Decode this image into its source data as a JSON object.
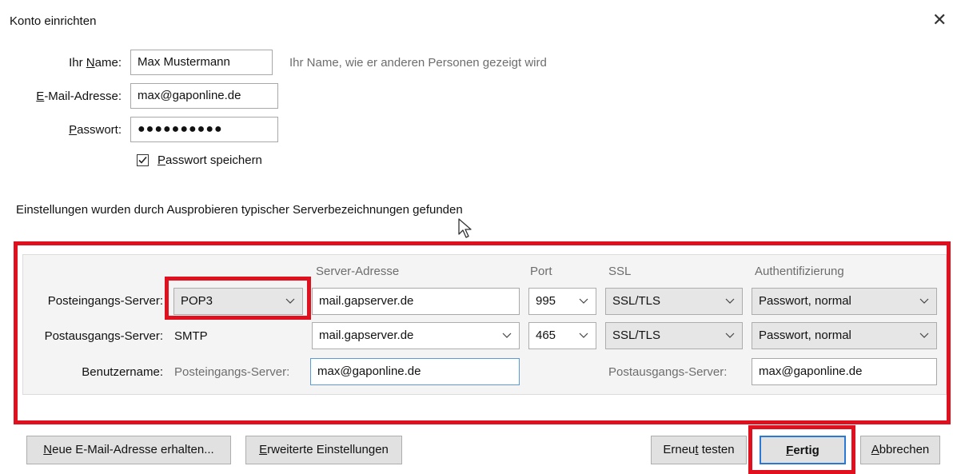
{
  "dialog": {
    "title": "Konto einrichten",
    "close_glyph": "✕"
  },
  "identity": {
    "name_label_pre": "Ihr ",
    "name_label_accel": "N",
    "name_label_post": "ame:",
    "name_value": "Max Mustermann",
    "name_hint": "Ihr Name, wie er anderen Personen gezeigt wird",
    "email_label_accel": "E",
    "email_label_post": "-Mail-Adresse:",
    "email_value": "max@gaponline.de",
    "password_label_accel": "P",
    "password_label_post": "asswort:",
    "password_value": "●●●●●●●●●●",
    "save_password_accel": "P",
    "save_password_post": "asswort speichern",
    "save_password_checked": true
  },
  "status_message": "Einstellungen wurden durch Ausprobieren typischer Serverbezeichnungen gefunden",
  "server_table": {
    "headers": {
      "address": "Server-Adresse",
      "port": "Port",
      "ssl": "SSL",
      "auth": "Authentifizierung"
    },
    "incoming": {
      "label": "Posteingangs-Server:",
      "protocol": "POP3",
      "address": "mail.gapserver.de",
      "port": "995",
      "ssl": "SSL/TLS",
      "auth": "Passwort, normal"
    },
    "outgoing": {
      "label": "Postausgangs-Server:",
      "protocol": "SMTP",
      "address": "mail.gapserver.de",
      "port": "465",
      "ssl": "SSL/TLS",
      "auth": "Passwort, normal"
    },
    "username": {
      "label": "Benutzername:",
      "incoming_label": "Posteingangs-Server:",
      "incoming_value": "max@gaponline.de",
      "outgoing_label": "Postausgangs-Server:",
      "outgoing_value": "max@gaponline.de"
    }
  },
  "buttons": {
    "new_address_accel": "N",
    "new_address_post": "eue E-Mail-Adresse erhalten...",
    "advanced_accel": "E",
    "advanced_post": "rweiterte Einstellungen",
    "retest_pre": "Erneu",
    "retest_accel": "t",
    "retest_post": " testen",
    "done_accel": "F",
    "done_post": "ertig",
    "cancel_accel": "A",
    "cancel_post": "bbrechen"
  },
  "annotation_color": "#e0101e",
  "icons": [
    "close-icon",
    "checkbox-check-icon",
    "chevron-down-icon",
    "mouse-cursor-icon"
  ]
}
